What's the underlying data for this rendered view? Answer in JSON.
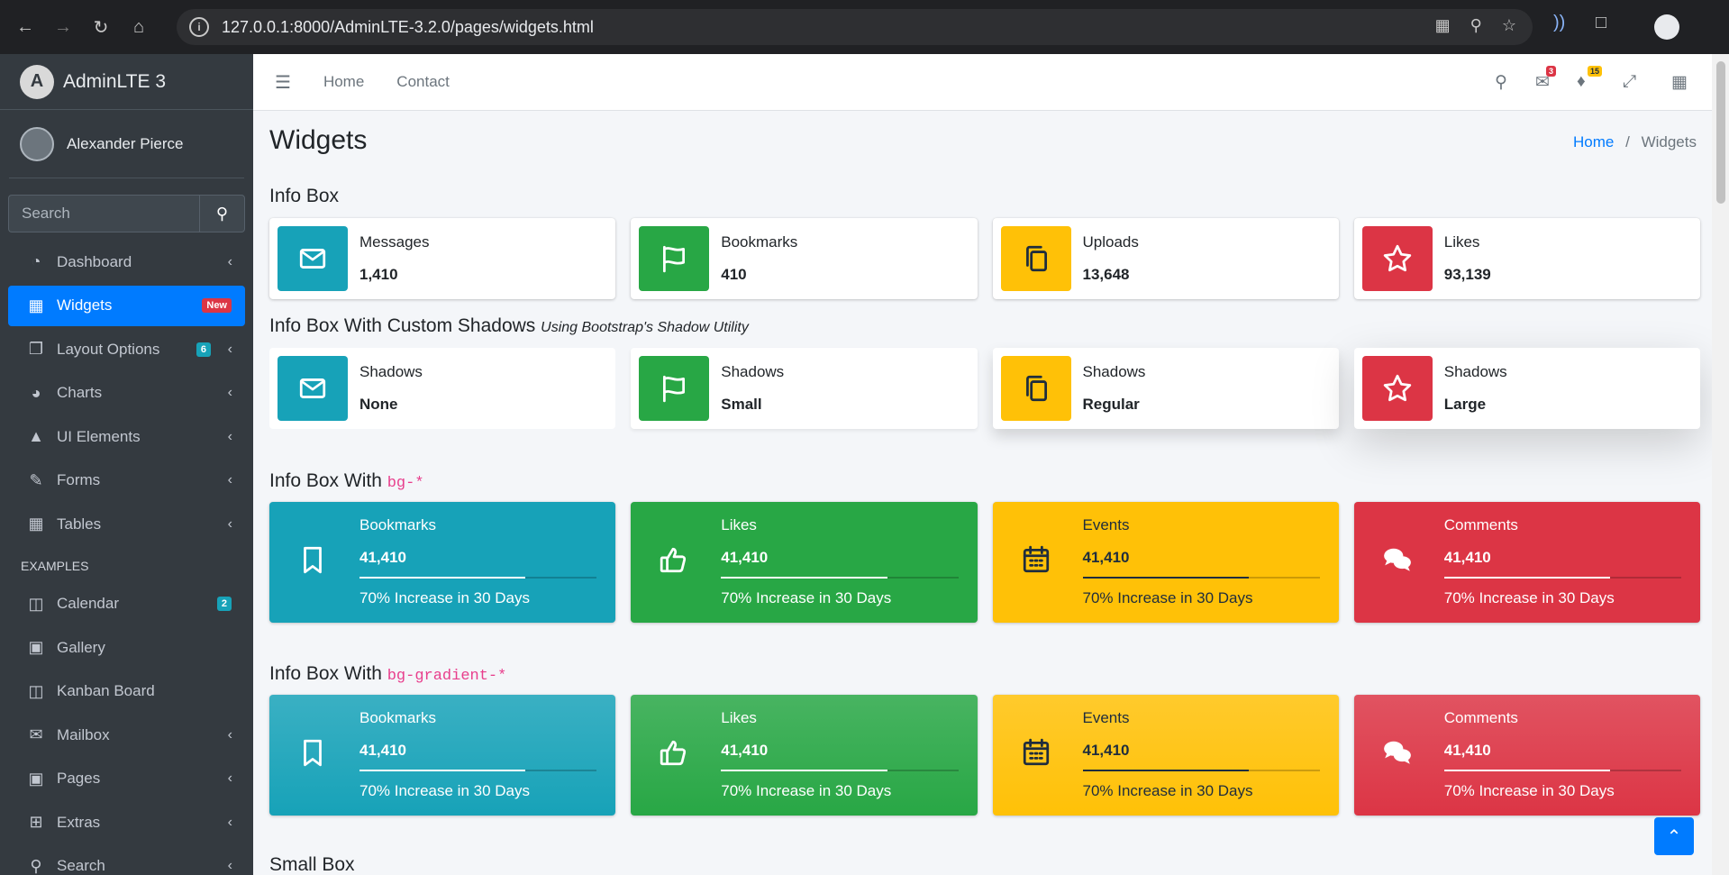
{
  "browser": {
    "url": "127.0.0.1:8000/AdminLTE-3.2.0/pages/widgets.html"
  },
  "sidebar": {
    "brand": "AdminLTE 3",
    "user": "Alexander Pierce",
    "search_placeholder": "Search",
    "items": [
      {
        "label": "Dashboard",
        "icon": "dashboard-icon",
        "arrow": true
      },
      {
        "label": "Widgets",
        "icon": "widgets-icon",
        "badge": "New",
        "badge_color": "#dc3545",
        "active": true
      },
      {
        "label": "Layout Options",
        "icon": "layout-icon",
        "badge": "6",
        "badge_color": "#17a2b8",
        "arrow": true
      },
      {
        "label": "Charts",
        "icon": "chart-pie-icon",
        "arrow": true
      },
      {
        "label": "UI Elements",
        "icon": "tree-icon",
        "arrow": true
      },
      {
        "label": "Forms",
        "icon": "edit-icon",
        "arrow": true
      },
      {
        "label": "Tables",
        "icon": "table-icon",
        "arrow": true
      }
    ],
    "header": "EXAMPLES",
    "examples": [
      {
        "label": "Calendar",
        "icon": "calendar-icon",
        "badge": "2",
        "badge_color": "#17a2b8"
      },
      {
        "label": "Gallery",
        "icon": "image-icon"
      },
      {
        "label": "Kanban Board",
        "icon": "columns-icon"
      },
      {
        "label": "Mailbox",
        "icon": "envelope-icon",
        "arrow": true
      },
      {
        "label": "Pages",
        "icon": "book-icon",
        "arrow": true
      },
      {
        "label": "Extras",
        "icon": "plus-square-icon",
        "arrow": true
      },
      {
        "label": "Search",
        "icon": "search-icon",
        "arrow": true
      }
    ]
  },
  "topbar": {
    "home": "Home",
    "contact": "Contact",
    "messages_badge": "3",
    "notifications_badge": "15"
  },
  "page": {
    "title": "Widgets",
    "breadcrumb_home": "Home",
    "breadcrumb_current": "Widgets",
    "sec1": "Info Box",
    "sec2": "Info Box With Custom Shadows",
    "sec2_sub": "Using Bootstrap's Shadow Utility",
    "sec3": "Info Box With ",
    "sec3_code": "bg-*",
    "sec4": "Info Box With ",
    "sec4_code": "bg-gradient-*",
    "sec5": "Small Box"
  },
  "colors": {
    "info": "#17a2b8",
    "success": "#28a745",
    "warning": "#ffc107",
    "danger": "#dc3545"
  },
  "info_boxes": [
    {
      "label": "Messages",
      "value": "1,410",
      "icon": "envelope-icon",
      "color": "info"
    },
    {
      "label": "Bookmarks",
      "value": "410",
      "icon": "flag-icon",
      "color": "success"
    },
    {
      "label": "Uploads",
      "value": "13,648",
      "icon": "copy-icon",
      "color": "warning"
    },
    {
      "label": "Likes",
      "value": "93,139",
      "icon": "star-icon",
      "color": "danger"
    }
  ],
  "shadow_boxes": [
    {
      "label": "Shadows",
      "value": "None",
      "icon": "envelope-icon",
      "color": "info"
    },
    {
      "label": "Shadows",
      "value": "Small",
      "icon": "flag-icon",
      "color": "success"
    },
    {
      "label": "Shadows",
      "value": "Regular",
      "icon": "copy-icon",
      "color": "warning"
    },
    {
      "label": "Shadows",
      "value": "Large",
      "icon": "star-icon",
      "color": "danger"
    }
  ],
  "bg_boxes": [
    {
      "label": "Bookmarks",
      "value": "41,410",
      "desc": "70% Increase in 30 Days",
      "progress": 70,
      "icon": "bookmark-icon",
      "color": "info"
    },
    {
      "label": "Likes",
      "value": "41,410",
      "desc": "70% Increase in 30 Days",
      "progress": 70,
      "icon": "thumbs-up-icon",
      "color": "success"
    },
    {
      "label": "Events",
      "value": "41,410",
      "desc": "70% Increase in 30 Days",
      "progress": 70,
      "icon": "calendar-icon",
      "color": "warning"
    },
    {
      "label": "Comments",
      "value": "41,410",
      "desc": "70% Increase in 30 Days",
      "progress": 70,
      "icon": "comments-icon",
      "color": "danger"
    }
  ],
  "gradient_boxes": [
    {
      "label": "Bookmarks",
      "value": "41,410",
      "desc": "70% Increase in 30 Days",
      "progress": 70,
      "icon": "bookmark-icon",
      "color": "info"
    },
    {
      "label": "Likes",
      "value": "41,410",
      "desc": "70% Increase in 30 Days",
      "progress": 70,
      "icon": "thumbs-up-icon",
      "color": "success"
    },
    {
      "label": "Events",
      "value": "41,410",
      "desc": "70% Increase in 30 Days",
      "progress": 70,
      "icon": "calendar-icon",
      "color": "warning"
    },
    {
      "label": "Comments",
      "value": "41,410",
      "desc": "70% Increase in 30 Days",
      "progress": 70,
      "icon": "comments-icon",
      "color": "danger"
    }
  ]
}
